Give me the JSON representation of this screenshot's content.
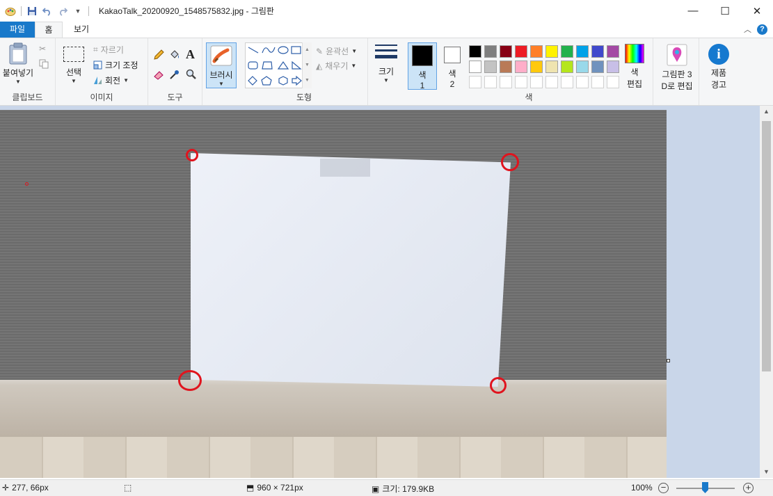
{
  "window": {
    "title": "KakaoTalk_20200920_1548575832.jpg - 그림판",
    "minimize": "—",
    "maximize": "☐",
    "close": "✕"
  },
  "tabs": {
    "file": "파일",
    "home": "홈",
    "view": "보기"
  },
  "ribbon": {
    "clipboard": {
      "label": "클립보드",
      "paste": "붙여넣기"
    },
    "image": {
      "label": "이미지",
      "select": "선택",
      "crop": "자르기",
      "resize": "크기 조정",
      "rotate": "회전"
    },
    "tools": {
      "label": "도구"
    },
    "brushes": {
      "label": "브러시"
    },
    "shapes": {
      "label": "도형",
      "outline": "윤곽선",
      "fill": "채우기"
    },
    "size": {
      "label": "크기"
    },
    "colors": {
      "label": "색",
      "color1_line1": "색",
      "color1_line2": "1",
      "color2_line1": "색",
      "color2_line2": "2",
      "edit_line1": "색",
      "edit_line2": "편집",
      "color1": "#000000",
      "color2": "#ffffff",
      "palette": [
        "#000000",
        "#7f7f7f",
        "#880015",
        "#ed1c24",
        "#ff7f27",
        "#fff200",
        "#22b14c",
        "#00a2e8",
        "#3f48cc",
        "#a349a4",
        "#ffffff",
        "#c3c3c3",
        "#b97a57",
        "#ffaec9",
        "#ffc90e",
        "#efe4b0",
        "#b5e61d",
        "#99d9ea",
        "#7092be",
        "#c8bfe7",
        "#ffffff",
        "#ffffff",
        "#ffffff",
        "#ffffff",
        "#ffffff",
        "#ffffff",
        "#ffffff",
        "#ffffff",
        "#ffffff",
        "#ffffff"
      ]
    },
    "paint3d": {
      "line1": "그림판 3",
      "line2": "D로 편집"
    },
    "product_alert": {
      "line1": "제품",
      "line2": "경고"
    }
  },
  "status": {
    "cursor": "277, 66px",
    "dimensions": "960 × 721px",
    "filesize": "크기: 179.9KB",
    "zoom": "100%"
  }
}
